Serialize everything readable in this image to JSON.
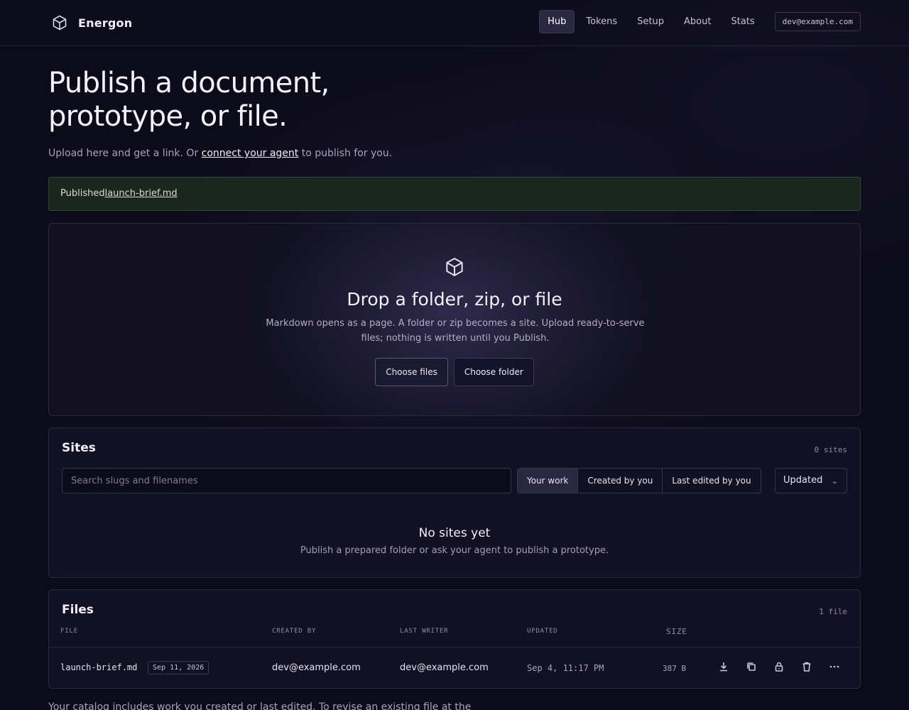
{
  "app": {
    "brand_name": "Energon",
    "user_email": "dev@example.com"
  },
  "nav": {
    "items": [
      {
        "label": "Hub",
        "active": true
      },
      {
        "label": "Tokens",
        "active": false
      },
      {
        "label": "Setup",
        "active": false
      },
      {
        "label": "About",
        "active": false
      },
      {
        "label": "Stats",
        "active": false
      }
    ]
  },
  "hero": {
    "title_line1": "Publish a document,",
    "title_line2": "prototype, or file.",
    "subtitle_before": "Upload here and get a link. Or ",
    "subtitle_link": "connect your agent",
    "subtitle_after": " to publish for you."
  },
  "notice": {
    "prefix": "Published",
    "link": "launch-brief.md"
  },
  "dropzone": {
    "title": "Drop a folder, zip, or file",
    "text": "Markdown opens as a page. A folder or zip becomes a site. Upload ready-to-serve files; nothing is written until you Publish.",
    "choose_files": "Choose files",
    "choose_folder": "Choose folder"
  },
  "sites": {
    "title": "Sites",
    "count": "0 sites",
    "search_placeholder": "Search slugs and filenames",
    "filters": [
      {
        "label": "Your work",
        "active": true
      },
      {
        "label": "Created by you",
        "active": false
      },
      {
        "label": "Last edited by you",
        "active": false
      }
    ],
    "sort_label": "Updated",
    "empty_title": "No sites yet",
    "empty_sub": "Publish a prepared folder or ask your agent to publish a prototype."
  },
  "files": {
    "title": "Files",
    "count": "1 file",
    "columns": {
      "file": "File",
      "created_by": "Created by",
      "last_writer": "Last writer",
      "updated": "Updated",
      "size": "SIZE"
    },
    "rows": [
      {
        "name": "launch-brief.md",
        "expiry": "Sep 11, 2026",
        "created_by": "dev@example.com",
        "last_writer": "dev@example.com",
        "updated": "Sep 4, 11:17 PM",
        "size": "387 B"
      }
    ],
    "action_icons": [
      "download-icon",
      "copy-icon",
      "lock-icon",
      "trash-icon",
      "more-icon"
    ]
  },
  "footer": {
    "note": "Your catalog includes work you created or last edited. To revise an existing file at the"
  },
  "colors": {
    "background": "#0c0b1a",
    "notice_bg": "#1b2620",
    "accent_active": "#2a2840"
  }
}
